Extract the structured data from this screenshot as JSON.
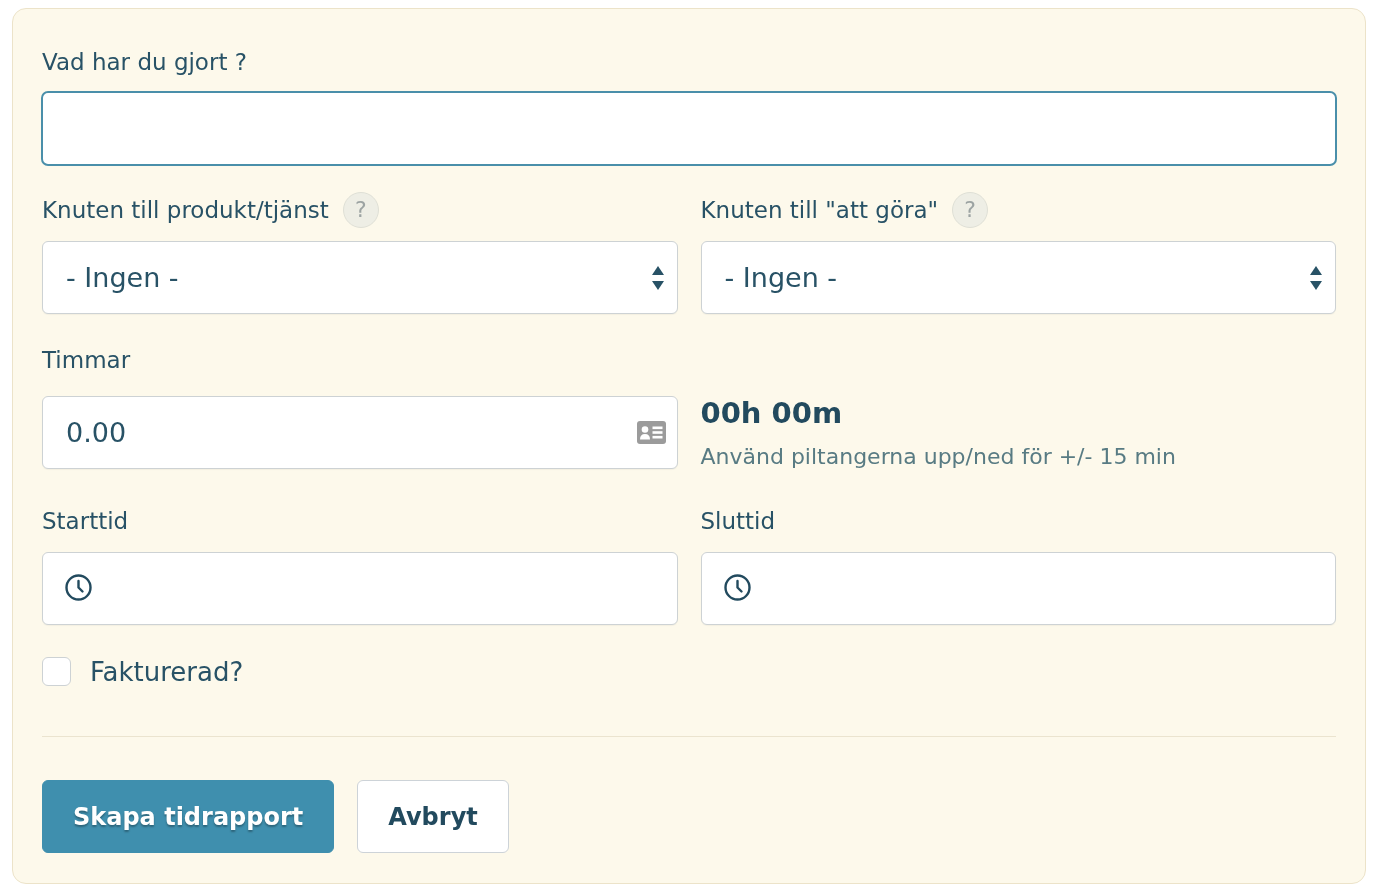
{
  "description": {
    "label": "Vad har du gjort ?",
    "focused": true
  },
  "links": [
    {
      "label": "Knuten till produkt/tjänst",
      "help": "?",
      "value": "- Ingen -"
    },
    {
      "label": "Knuten till \"att göra\"",
      "help": "?",
      "value": "- Ingen -"
    }
  ],
  "hours": {
    "label": "Timmar",
    "value": "0.00"
  },
  "duration": {
    "value": "00h 00m",
    "hint": "Använd piltangerna upp/ned för +/- 15 min"
  },
  "times": [
    {
      "label": "Starttid"
    },
    {
      "label": "Sluttid"
    }
  ],
  "invoiced": {
    "label": "Fakturerad?",
    "checked": false
  },
  "buttons": [
    {
      "label": "Skapa tidrapport",
      "kind": "primary"
    },
    {
      "label": "Avbryt",
      "kind": "secondary"
    }
  ]
}
